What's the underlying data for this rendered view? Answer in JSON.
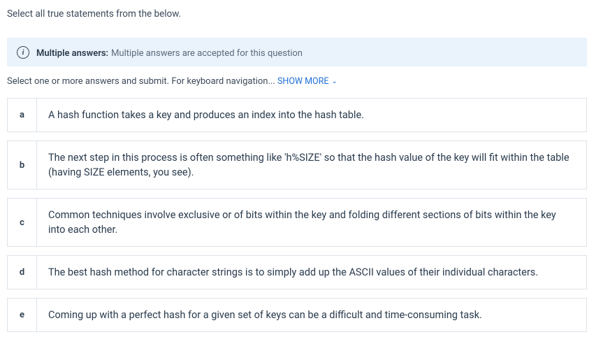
{
  "prompt": "Select all true statements from the below.",
  "banner": {
    "icon_glyph": "i",
    "label": "Multiple answers:",
    "text": "Multiple answers are accepted for this question"
  },
  "nav_hint": {
    "prefix": "Select one or more answers and submit. For keyboard navigation... ",
    "show_more": "SHOW MORE"
  },
  "options": {
    "a": {
      "label": "a",
      "text": "A hash function takes a key and produces an index into the hash table."
    },
    "b": {
      "label": "b",
      "text": "The next step in this process is often something like 'h%SIZE' so that the hash value of the key will fit within the table (having SIZE elements, you see)."
    },
    "c": {
      "label": "c",
      "text": "Common techniques involve exclusive or of bits within the key and folding different sections of bits within the key into each other."
    },
    "d": {
      "label": "d",
      "text": "The best hash method for character strings is to simply add up the ASCII values of their individual characters."
    },
    "e": {
      "label": "e",
      "text": "Coming up with a perfect hash for a given set of keys can be a difficult and time-consuming task."
    }
  }
}
